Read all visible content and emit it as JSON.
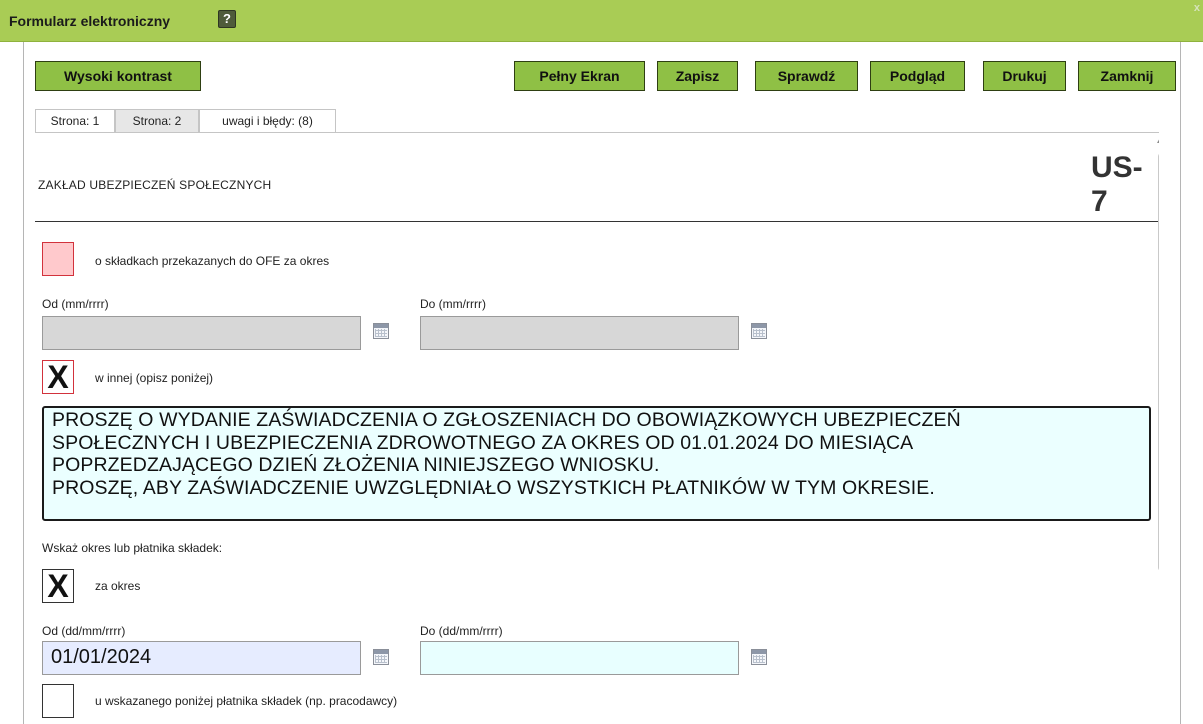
{
  "titlebar": {
    "title": "Formularz elektroniczny",
    "help_glyph": "?",
    "close_glyph": "x"
  },
  "toolbar": {
    "contrast_label": "Wysoki kontrast",
    "fullscreen_label": "Pełny Ekran",
    "save_label": "Zapisz",
    "check_label": "Sprawdź",
    "preview_label": "Podgląd",
    "print_label": "Drukuj",
    "close_label": "Zamknij"
  },
  "tabs": [
    {
      "label": "Strona: 1",
      "active": false
    },
    {
      "label": "Strona: 2",
      "active": true
    },
    {
      "label": "uwagi i błędy: (8)",
      "active": false
    }
  ],
  "form": {
    "organization": "ZAKŁAD UBEZPIECZEŃ SPOŁECZNYCH",
    "code": "US-7",
    "ofe": {
      "checked_mark": "",
      "label": "o składkach przekazanych do OFE za okres",
      "from_label": "Od (mm/rrrr)",
      "from_value": "",
      "to_label": "Do (mm/rrrr)",
      "to_value": ""
    },
    "other": {
      "checked_mark": "X",
      "label": "w innej (opisz poniżej)",
      "description": "PROSZĘ O WYDANIE ZAŚWIADCZENIA O ZGŁOSZENIACH DO OBOWIĄZKOWYCH UBEZPIECZEŃ\nSPOŁECZNYCH I UBEZPIECZENIA ZDROWOTNEGO ZA OKRES OD 01.01.2024 DO MIESIĄCA\nPOPRZEDZAJĄCEGO DZIEŃ ZŁOŻENIA NINIEJSZEGO WNIOSKU.\nPROSZĘ, ABY ZAŚWIADCZENIE UWZGLĘDNIAŁO WSZYSTKICH PŁATNIKÓW W TYM OKRESIE."
    },
    "period_question": "Wskaż okres lub płatnika składek:",
    "period": {
      "checked_mark": "X",
      "label": "za okres",
      "from_label": "Od (dd/mm/rrrr)",
      "from_value": "01/01/2024",
      "to_label": "Do (dd/mm/rrrr)",
      "to_value": ""
    },
    "payer": {
      "checked_mark": "",
      "label": "u wskazanego poniżej płatnika składek (np. pracodawcy)"
    }
  },
  "colors": {
    "titlebar_bg": "#a9cc55",
    "button_bg": "#8fc045",
    "error_border": "#d2323c",
    "error_fill": "#ffc9cc",
    "textarea_bg": "#ebffff",
    "date_blue": "#e6ecff",
    "date_cyan": "#e8ffff"
  },
  "icons": {
    "calendar": "calendar-icon",
    "help": "help-icon",
    "close": "close-icon"
  }
}
